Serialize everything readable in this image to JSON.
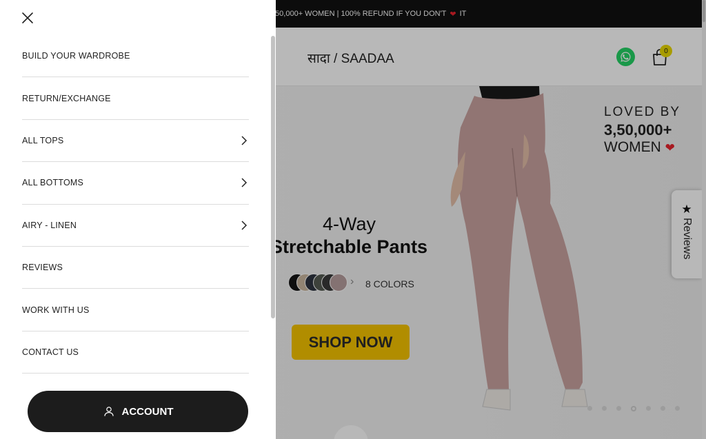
{
  "announcement": {
    "text_before": ",50,000+ WOMEN | 100% REFUND IF YOU DON'T",
    "heart": "❤",
    "text_after": "IT"
  },
  "header": {
    "logo": "सादा / SAADAA",
    "cart_count": "0",
    "whatsapp_icon": "whatsapp-icon",
    "bag_icon": "shopping-bag-icon"
  },
  "hero": {
    "loved_line1": "LOVED BY",
    "loved_line2": "3,50,000+",
    "loved_line3": "WOMEN",
    "heart": "❤",
    "title_line1": "4-Way",
    "title_line2": "Stretchable Pants",
    "swatch_colors": [
      "#151515",
      "#cbb8a0",
      "#2e3440",
      "#555b52",
      "#3a3a3a",
      "#b79e9e"
    ],
    "colors_label": "8 COLORS",
    "cta": "SHOP NOW",
    "carousel_total": 7,
    "carousel_active": 4
  },
  "reviews_tab": {
    "star": "★",
    "label": "Reviews"
  },
  "drawer": {
    "close_icon": "close-icon",
    "items": [
      {
        "label": "BUILD YOUR WARDROBE",
        "has_submenu": false
      },
      {
        "label": "RETURN/EXCHANGE",
        "has_submenu": false
      },
      {
        "label": "ALL TOPS",
        "has_submenu": true
      },
      {
        "label": "ALL BOTTOMS",
        "has_submenu": true
      },
      {
        "label": "AIRY - LINEN",
        "has_submenu": true
      },
      {
        "label": "REVIEWS",
        "has_submenu": false
      },
      {
        "label": "WORK WITH US",
        "has_submenu": false
      },
      {
        "label": "CONTACT US",
        "has_submenu": false
      }
    ],
    "account_label": "ACCOUNT",
    "account_icon": "user-icon"
  },
  "colors": {
    "announcement_bg": "#111111",
    "cta_bg": "#f5c400",
    "account_bg": "#1c1c1c",
    "badge_bg": "#e9d800",
    "heart": "#e8232d"
  }
}
